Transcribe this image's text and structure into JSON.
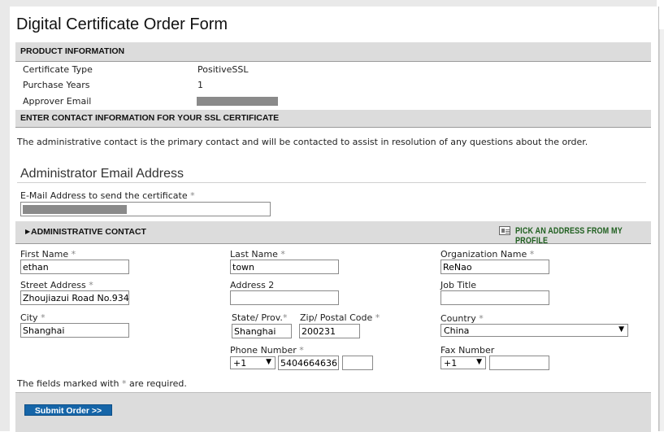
{
  "title": "Digital Certificate Order Form",
  "product_section": {
    "header": "PRODUCT INFORMATION",
    "rows": [
      {
        "label": "Certificate Type",
        "value": "PositiveSSL"
      },
      {
        "label": "Purchase Years",
        "value": "1"
      },
      {
        "label": "Approver Email",
        "value": ""
      }
    ]
  },
  "contact_section": {
    "header": "ENTER CONTACT INFORMATION FOR YOUR SSL CERTIFICATE",
    "note": "The administrative contact is the primary contact and will be contacted to assist in resolution of any questions about the order."
  },
  "admin_email": {
    "heading": "Administrator Email Address",
    "field_label": "E-Mail Address to send the certificate",
    "value": ""
  },
  "admin_contact": {
    "header": "ADMINISTRATIVE CONTACT",
    "profile_link": "PICK AN ADDRESS FROM MY PROFILE",
    "first_name": {
      "label": "First Name",
      "value": "ethan"
    },
    "last_name": {
      "label": "Last Name",
      "value": "town"
    },
    "organization": {
      "label": "Organization Name",
      "value": "ReNao"
    },
    "street": {
      "label": "Street Address",
      "value": "Zhoujiazui Road No.934"
    },
    "address2": {
      "label": "Address 2",
      "value": ""
    },
    "job_title": {
      "label": "Job Title",
      "value": ""
    },
    "city": {
      "label": "City",
      "value": "Shanghai"
    },
    "state": {
      "label": "State/ Prov.",
      "value": "Shanghai"
    },
    "zip": {
      "label": "Zip/ Postal Code",
      "value": "200231"
    },
    "country": {
      "label": "Country",
      "value": "China"
    },
    "phone": {
      "label": "Phone Number",
      "code": "+1",
      "number": "5404664636",
      "ext": ""
    },
    "fax": {
      "label": "Fax Number",
      "code": "+1",
      "number": ""
    }
  },
  "required_marker": "*",
  "required_note_prefix": "The fields marked with",
  "required_note_suffix": "are required.",
  "submit_label": "Submit Order >>"
}
